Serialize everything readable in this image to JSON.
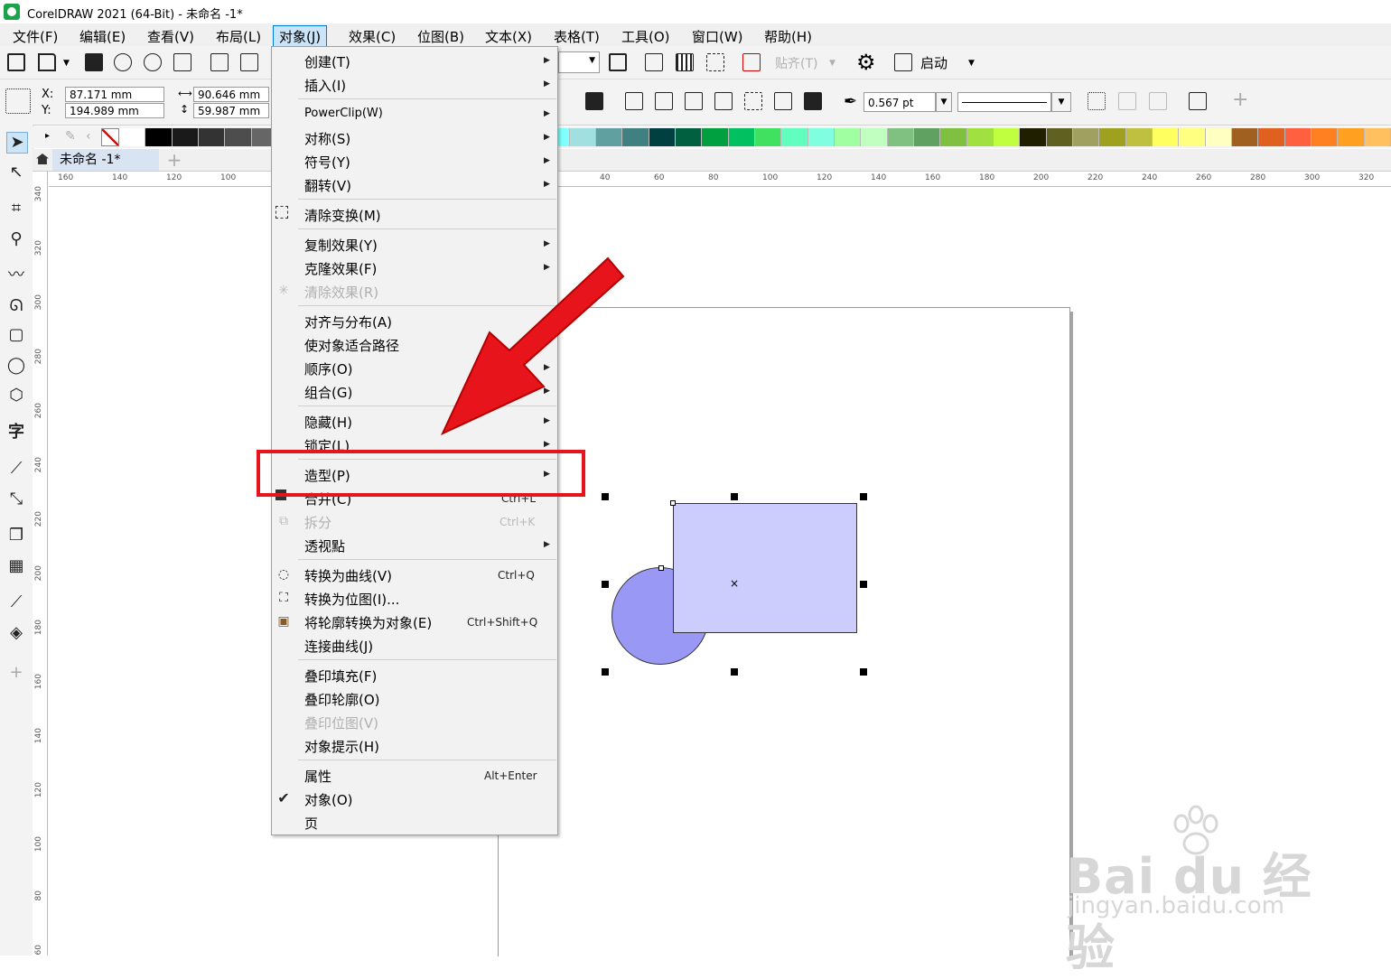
{
  "window": {
    "title": "CorelDRAW 2021 (64-Bit) - 未命名 -1*"
  },
  "menubar": [
    {
      "label": "文件(F)"
    },
    {
      "label": "编辑(E)"
    },
    {
      "label": "查看(V)"
    },
    {
      "label": "布局(L)"
    },
    {
      "label": "对象(J)"
    },
    {
      "label": "效果(C)"
    },
    {
      "label": "位图(B)"
    },
    {
      "label": "文本(X)"
    },
    {
      "label": "表格(T)"
    },
    {
      "label": "工具(O)"
    },
    {
      "label": "窗口(W)"
    },
    {
      "label": "帮助(H)"
    }
  ],
  "toolbar": {
    "paste_label": "贴齐(T)",
    "launch_label": "启动"
  },
  "properties": {
    "x_label": "X:",
    "y_label": "Y:",
    "x_value": "87.171 mm",
    "y_value": "194.989 mm",
    "width_value": "90.646 mm",
    "height_value": "59.987 mm",
    "outline_width": "0.567 pt"
  },
  "doc_tab": {
    "label": "未命名 -1*"
  },
  "hruler_ticks": [
    "160",
    "140",
    "120",
    "100",
    "40",
    "60",
    "80",
    "100",
    "120",
    "140",
    "160",
    "180",
    "200",
    "220",
    "240",
    "260",
    "280",
    "300",
    "320"
  ],
  "vruler_ticks": [
    "340",
    "320",
    "300",
    "280",
    "260",
    "240",
    "220",
    "200",
    "180",
    "160",
    "140",
    "120",
    "100",
    "80",
    "60"
  ],
  "menu": {
    "create": "创建(T)",
    "insert": "插入(I)",
    "powerclip": "PowerClip(W)",
    "symmetry": "对称(S)",
    "symbol": "符号(Y)",
    "flip": "翻转(V)",
    "clear_transform": "清除变换(M)",
    "copy_effect": "复制效果(Y)",
    "clone_effect": "克隆效果(F)",
    "clear_effect": "清除效果(R)",
    "align": "对齐与分布(A)",
    "fit_path": "使对象适合路径",
    "order": "顺序(O)",
    "group": "组合(G)",
    "hide": "隐藏(H)",
    "lock": "锁定(L)",
    "shaping": "造型(P)",
    "combine": "合并(C)",
    "combine_shortcut": "Ctrl+L",
    "break_apart": "拆分",
    "break_apart_shortcut": "Ctrl+K",
    "perspective": "透视點",
    "to_curves": "转换为曲线(V)",
    "to_curves_shortcut": "Ctrl+Q",
    "to_bitmap": "转换为位图(I)...",
    "outline_to_object": "将轮廓转换为对象(E)",
    "outline_to_object_shortcut": "Ctrl+Shift+Q",
    "join_curves": "连接曲线(J)",
    "overprint_fill": "叠印填充(F)",
    "overprint_outline": "叠印轮廓(O)",
    "overprint_bitmap": "叠印位图(V)",
    "object_hints": "对象提示(H)",
    "properties": "属性",
    "properties_shortcut": "Alt+Enter",
    "objects": "对象(O)",
    "page": "页"
  },
  "palette_colors": [
    "#ffffff",
    "#000000",
    "#1a1a1a",
    "#333333",
    "#4d4d4d",
    "#666666",
    "#808080",
    "#999999",
    "#b3b3b3",
    "#8080ff",
    "#6666ff",
    "#4040c0",
    "#2020a0",
    "#000080",
    "#3070b0",
    "#00b0f0",
    "#80ffff",
    "#a0e0e0",
    "#60a0a0",
    "#408080",
    "#004040",
    "#006040",
    "#00a040",
    "#00c060",
    "#40e060",
    "#60ffc0",
    "#80ffe0",
    "#a0ffa0",
    "#c0ffc0",
    "#80c080",
    "#60a060",
    "#80c040",
    "#a0e040",
    "#c0ff40",
    "#202000",
    "#606020",
    "#a0a060",
    "#a0a020",
    "#c0c040",
    "#ffff60",
    "#ffff80",
    "#ffffc0",
    "#a06020",
    "#e06020",
    "#ff6040",
    "#ff8020",
    "#ffa020",
    "#ffc060"
  ],
  "watermark": {
    "brand": "Bai du 经验",
    "url": "jingyan.baidu.com"
  },
  "colors": {
    "accent": "#0078d7",
    "highlight": "#e8141b",
    "circle_fill": "#9999f5",
    "rect_fill": "#ccccfd"
  }
}
